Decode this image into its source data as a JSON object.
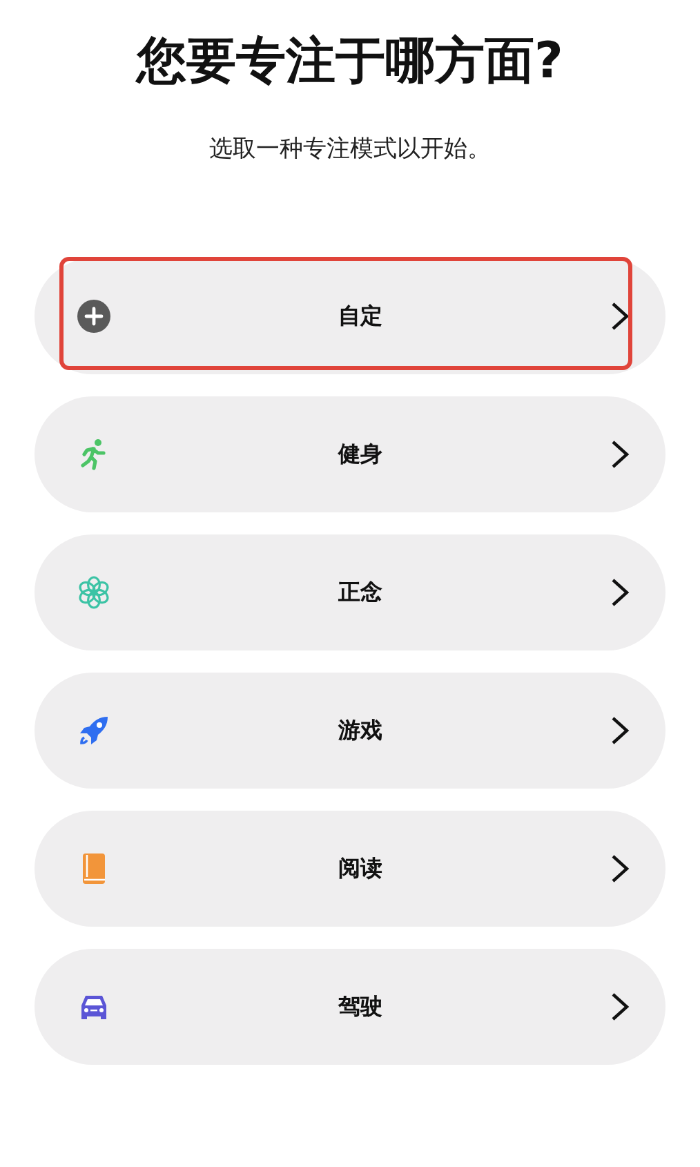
{
  "title": "您要专注于哪方面?",
  "subtitle": "选取一种专注模式以开始。",
  "modes": [
    {
      "kind": "custom",
      "label": "自定",
      "highlighted": true
    },
    {
      "kind": "fitness",
      "label": "健身",
      "highlighted": false
    },
    {
      "kind": "mindfulness",
      "label": "正念",
      "highlighted": false
    },
    {
      "kind": "gaming",
      "label": "游戏",
      "highlighted": false
    },
    {
      "kind": "reading",
      "label": "阅读",
      "highlighted": false
    },
    {
      "kind": "driving",
      "label": "驾驶",
      "highlighted": false
    }
  ]
}
